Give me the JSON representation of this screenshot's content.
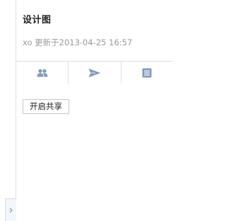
{
  "header": {
    "title": "设计图",
    "updated_text": "xo 更新于2013-04-25 16:57"
  },
  "tabs": [
    {
      "icon": "people-icon",
      "active": true
    },
    {
      "icon": "send-icon",
      "active": false
    },
    {
      "icon": "document-icon",
      "active": false
    }
  ],
  "content": {
    "share_button_label": "开启共享"
  },
  "colors": {
    "icon": "#7f9bbd",
    "border": "#d7dfe9",
    "muted_text": "#9a9a9a"
  }
}
